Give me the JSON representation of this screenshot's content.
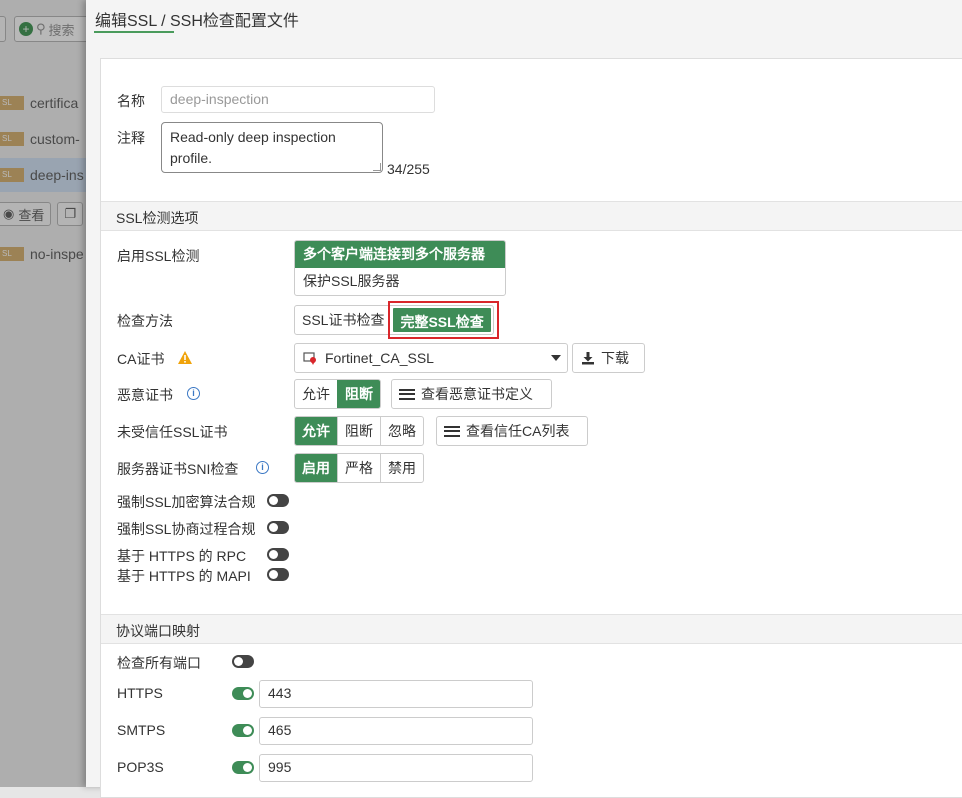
{
  "background": {
    "search_placeholder": "搜索",
    "rows": [
      {
        "tag": "SL",
        "name": "certifica"
      },
      {
        "tag": "SL",
        "name": "custom-"
      },
      {
        "tag": "SL",
        "name": "deep-ins"
      },
      {
        "tag": "SL",
        "name": "no-inspe"
      }
    ],
    "actions": {
      "view": "查看"
    }
  },
  "panel": {
    "title": "编辑SSL / SSH检查配置文件"
  },
  "form": {
    "name_label": "名称",
    "name_value": "deep-inspection",
    "comment_label": "注释",
    "comment_value": "Read-only deep inspection profile.",
    "comment_counter": "34/255"
  },
  "ssl_section": {
    "title": "SSL检测选项",
    "enable_label": "启用SSL检测",
    "enable_options": [
      "多个客户端连接到多个服务器",
      "保护SSL服务器"
    ],
    "method_label": "检查方法",
    "method_options": [
      "SSL证书检查",
      "完整SSL检查"
    ],
    "ca_label": "CA证书",
    "ca_value": "Fortinet_CA_SSL",
    "download_label": "下载",
    "malicious_label": "恶意证书",
    "malicious_options": [
      "允许",
      "阻断"
    ],
    "malicious_view": "查看恶意证书定义",
    "untrusted_label": "未受信任SSL证书",
    "untrusted_options": [
      "允许",
      "阻断",
      "忽略"
    ],
    "untrusted_view": "查看信任CA列表",
    "sni_label": "服务器证书SNI检查",
    "sni_options": [
      "启用",
      "严格",
      "禁用"
    ],
    "cipher_label": "强制SSL加密算法合规",
    "negotiation_label": "强制SSL协商过程合规",
    "rpc_label": "基于 HTTPS 的 RPC",
    "mapi_label": "基于 HTTPS 的 MAPI"
  },
  "port_section": {
    "title": "协议端口映射",
    "all_ports_label": "检查所有端口",
    "https_label": "HTTPS",
    "https_port": "443",
    "smtps_label": "SMTPS",
    "smtps_port": "465",
    "pop3s_label": "POP3S",
    "pop3s_port": "995"
  },
  "colors": {
    "accent": "#3e8c57",
    "highlight": "#d9262b",
    "info": "#3b78c4",
    "warning": "#f0a30a"
  }
}
